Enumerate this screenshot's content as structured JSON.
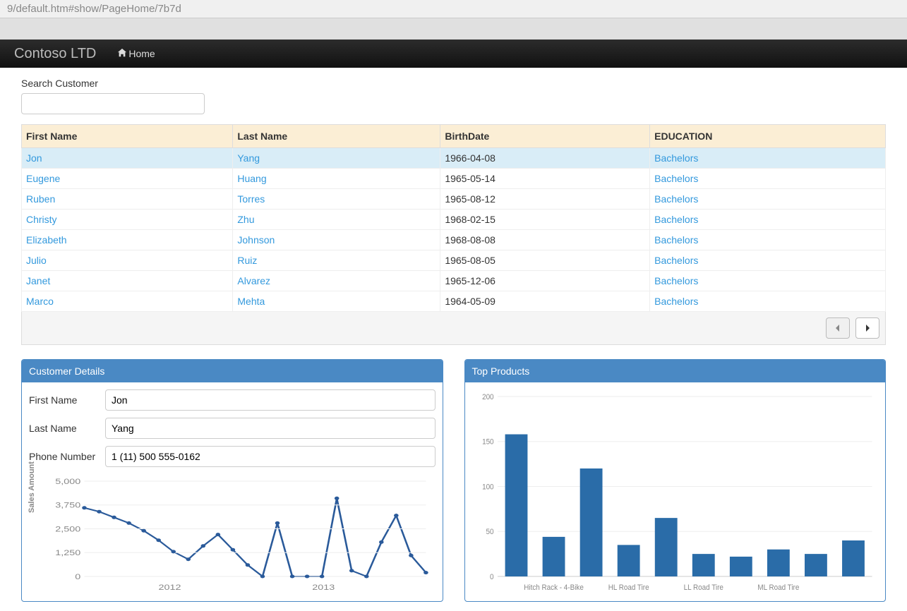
{
  "url_fragment": "9/default.htm#show/PageHome/7b7d",
  "brand": "Contoso LTD",
  "nav": {
    "home": "Home"
  },
  "search": {
    "label": "Search Customer",
    "value": ""
  },
  "table": {
    "headers": [
      "First Name",
      "Last Name",
      "BirthDate",
      "EDUCATION"
    ],
    "rows": [
      {
        "first": "Jon",
        "last": "Yang",
        "birth": "1966-04-08",
        "edu": "Bachelors"
      },
      {
        "first": "Eugene",
        "last": "Huang",
        "birth": "1965-05-14",
        "edu": "Bachelors"
      },
      {
        "first": "Ruben",
        "last": "Torres",
        "birth": "1965-08-12",
        "edu": "Bachelors"
      },
      {
        "first": "Christy",
        "last": "Zhu",
        "birth": "1968-02-15",
        "edu": "Bachelors"
      },
      {
        "first": "Elizabeth",
        "last": "Johnson",
        "birth": "1968-08-08",
        "edu": "Bachelors"
      },
      {
        "first": "Julio",
        "last": "Ruiz",
        "birth": "1965-08-05",
        "edu": "Bachelors"
      },
      {
        "first": "Janet",
        "last": "Alvarez",
        "birth": "1965-12-06",
        "edu": "Bachelors"
      },
      {
        "first": "Marco",
        "last": "Mehta",
        "birth": "1964-05-09",
        "edu": "Bachelors"
      }
    ]
  },
  "details": {
    "title": "Customer Details",
    "first_label": "First Name",
    "first_value": "Jon",
    "last_label": "Last Name",
    "last_value": "Yang",
    "phone_label": "Phone Number",
    "phone_value": "1 (11) 500 555-0162"
  },
  "products": {
    "title": "Top Products"
  },
  "chart_data": [
    {
      "id": "sales_line",
      "type": "line",
      "title": "",
      "ylabel": "Sales Amount",
      "ylim": [
        0,
        5000
      ],
      "yticks": [
        0,
        1250,
        2500,
        3750,
        5000
      ],
      "xticks": [
        "2012",
        "2013"
      ],
      "x": [
        0,
        1,
        2,
        3,
        4,
        5,
        6,
        7,
        8,
        9,
        10,
        11,
        12,
        13,
        14,
        15,
        16,
        17,
        18,
        19,
        20,
        21,
        22,
        23
      ],
      "values": [
        3600,
        3400,
        3100,
        2800,
        2400,
        1900,
        1300,
        900,
        1600,
        2200,
        1400,
        600,
        0,
        2800,
        0,
        0,
        0,
        4100,
        300,
        0,
        1800,
        3200,
        1100,
        200
      ]
    },
    {
      "id": "top_products_bar",
      "type": "bar",
      "title": "Top Products",
      "ylim": [
        0,
        200
      ],
      "yticks": [
        0,
        50,
        100,
        150,
        200
      ],
      "categories": [
        "",
        "Hitch Rack - 4-Bike",
        "",
        "HL Road Tire",
        "",
        "LL Road Tire",
        "",
        "ML Road Tire",
        "",
        ""
      ],
      "values": [
        158,
        44,
        120,
        35,
        65,
        25,
        22,
        30,
        25,
        40
      ]
    }
  ]
}
